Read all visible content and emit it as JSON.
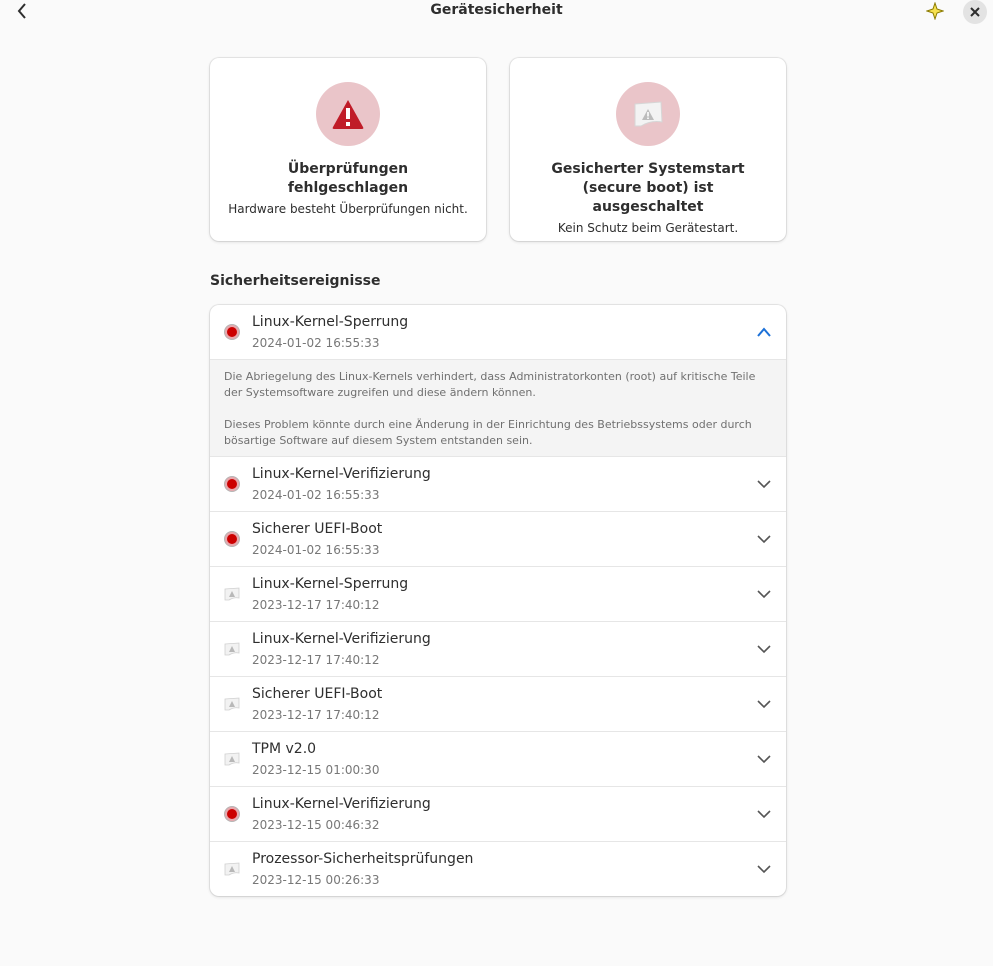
{
  "header": {
    "title": "Gerätesicherheit"
  },
  "cards": [
    {
      "title": "Überprüfungen fehlgeschlagen",
      "subtitle": "Hardware besteht Überprüfungen nicht.",
      "icon": "warning-triangle-icon",
      "color": "#c01c28"
    },
    {
      "title": "Gesicherter Systemstart (secure boot) ist ausgeschaltet",
      "subtitle": "Kein Schutz beim Gerätestart.",
      "icon": "boot-warning-icon"
    }
  ],
  "events_section": {
    "title": "Sicherheitsereignisse",
    "expanded_details": [
      "Die Abriegelung des Linux-Kernels verhindert, dass Administratorkonten (root) auf kritische Teile der Systemsoftware zugreifen und diese ändern können.",
      "Dieses Problem könnte durch eine Änderung in der Einrichtung des Betriebssystems oder durch bösartige Software auf diesem System entstanden sein."
    ],
    "events": [
      {
        "name": "Linux-Kernel-Sperrung",
        "time": "2024-01-02 16:55:33",
        "status": "red",
        "expanded": true
      },
      {
        "name": "Linux-Kernel-Verifizierung",
        "time": "2024-01-02 16:55:33",
        "status": "red"
      },
      {
        "name": "Sicherer UEFI-Boot",
        "time": "2024-01-02 16:55:33",
        "status": "red"
      },
      {
        "name": "Linux-Kernel-Sperrung",
        "time": "2023-12-17 17:40:12",
        "status": "gray"
      },
      {
        "name": "Linux-Kernel-Verifizierung",
        "time": "2023-12-17 17:40:12",
        "status": "gray"
      },
      {
        "name": "Sicherer UEFI-Boot",
        "time": "2023-12-17 17:40:12",
        "status": "gray"
      },
      {
        "name": "TPM v2.0",
        "time": "2023-12-15 01:00:30",
        "status": "gray"
      },
      {
        "name": "Linux-Kernel-Verifizierung",
        "time": "2023-12-15 00:46:32",
        "status": "red"
      },
      {
        "name": "Prozessor-Sicherheitsprüfungen",
        "time": "2023-12-15 00:26:33",
        "status": "gray"
      }
    ]
  },
  "colors": {
    "accent": "#1c71d8",
    "error": "#cc0000",
    "icon_bg": "#eac5c9"
  }
}
